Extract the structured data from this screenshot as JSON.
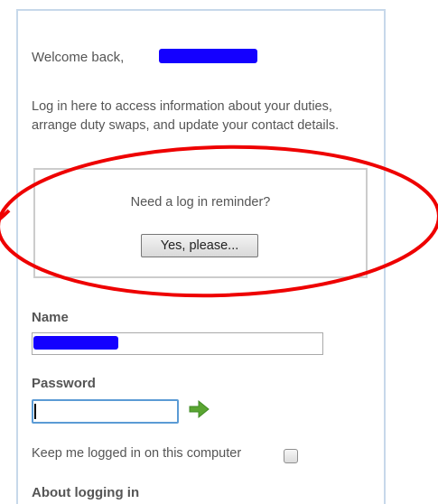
{
  "welcome": {
    "greeting": "Welcome back,"
  },
  "intro": {
    "text": "Log in here to access information about your duties, arrange duty swaps, and update your contact details."
  },
  "reminder": {
    "prompt": "Need a log in reminder?",
    "button_label": "Yes, please..."
  },
  "login_form": {
    "name_label": "Name",
    "password_label": "Password",
    "submit_icon": "green-right-arrow",
    "keep_logged_in_label": "Keep me logged in on this computer",
    "keep_logged_in_checked": false
  },
  "about": {
    "heading": "About logging in"
  },
  "colors": {
    "annotation": "#ee0000",
    "redaction": "#1400ff",
    "panel_border": "#c7d8ea",
    "focus_border": "#5b9bd5",
    "go_arrow": "#5aa532"
  }
}
